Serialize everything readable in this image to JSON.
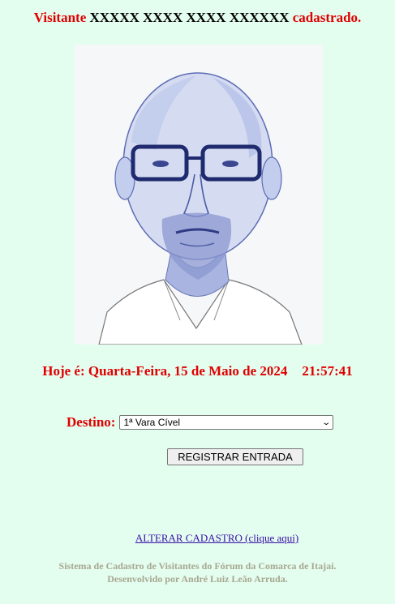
{
  "header": {
    "prefix": "Visitante",
    "name": "XXXXX XXXX XXXX XXXXXX",
    "suffix": "cadastrado."
  },
  "photo": {
    "icon": "visitor-portrait-sketch"
  },
  "date_line": {
    "label": "Hoje é: Quarta-Feira, 15 de Maio de 2024",
    "time": "21:57:41"
  },
  "form": {
    "destino_label": "Destino:",
    "destino_selected": "1ª Vara Cível",
    "register_button": "REGISTRAR ENTRADA"
  },
  "link": {
    "alter": "ALTERAR CADASTRO (clique aqui)"
  },
  "footer": {
    "line1": "Sistema de Cadastro de Visitantes do Fórum da Comarca de Itajaí.",
    "line2": "Desenvolvido por André Luiz Leão Arruda."
  },
  "colors": {
    "background": "#e3fdef",
    "accent_red": "#e00000",
    "link": "#3a0fa8",
    "footer": "#a8a890"
  }
}
